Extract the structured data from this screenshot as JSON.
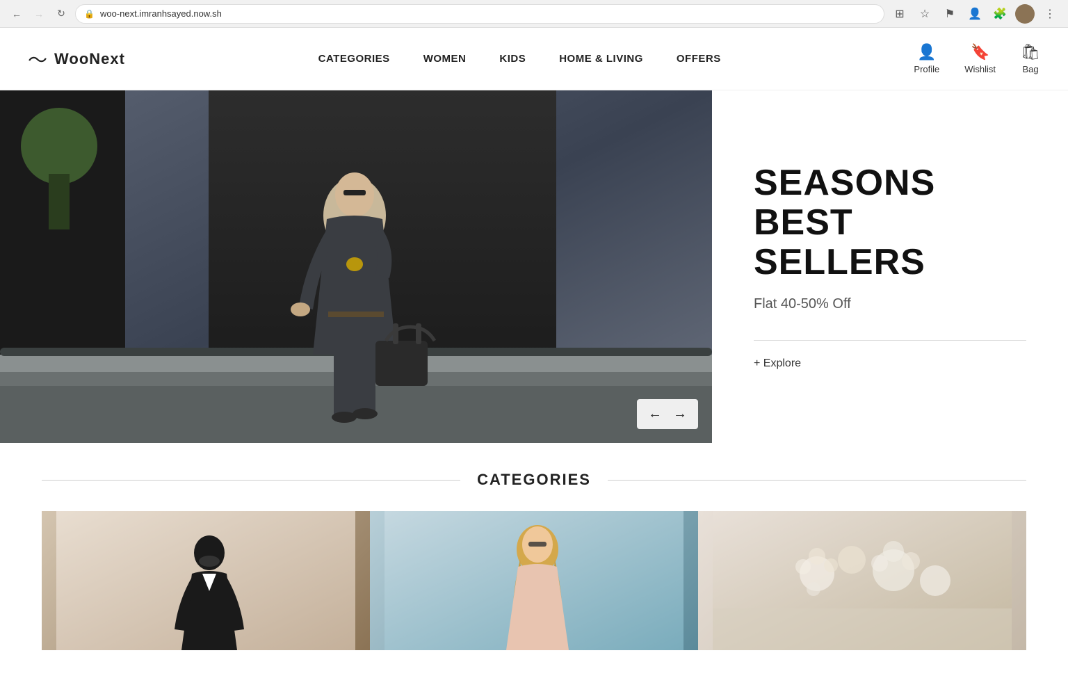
{
  "browser": {
    "url": "woo-next.imranhsayed.now.sh",
    "back_disabled": false,
    "forward_disabled": true
  },
  "header": {
    "logo_symbol": "〜",
    "logo_text": "WooNext",
    "nav": [
      {
        "label": "CATEGORIES",
        "id": "categories"
      },
      {
        "label": "WOMEN",
        "id": "women"
      },
      {
        "label": "KIDS",
        "id": "kids"
      },
      {
        "label": "HOME & LIVING",
        "id": "home-living"
      },
      {
        "label": "OFFERS",
        "id": "offers"
      }
    ],
    "actions": [
      {
        "label": "Profile",
        "icon": "👤",
        "id": "profile"
      },
      {
        "label": "Wishlist",
        "icon": "🔖",
        "id": "wishlist"
      },
      {
        "label": "Bag",
        "icon": "🛍",
        "id": "bag"
      }
    ]
  },
  "hero": {
    "title_line1": "SEASONS",
    "title_line2": "BEST SELLERS",
    "subtitle": "Flat 40-50% Off",
    "explore_label": "+ Explore",
    "prev_arrow": "←",
    "next_arrow": "→"
  },
  "categories_section": {
    "title": "CATEGORIES",
    "items": [
      {
        "id": "cat-1",
        "alt": "Men category"
      },
      {
        "id": "cat-2",
        "alt": "Women category"
      },
      {
        "id": "cat-3",
        "alt": "Home & Living category"
      }
    ]
  }
}
